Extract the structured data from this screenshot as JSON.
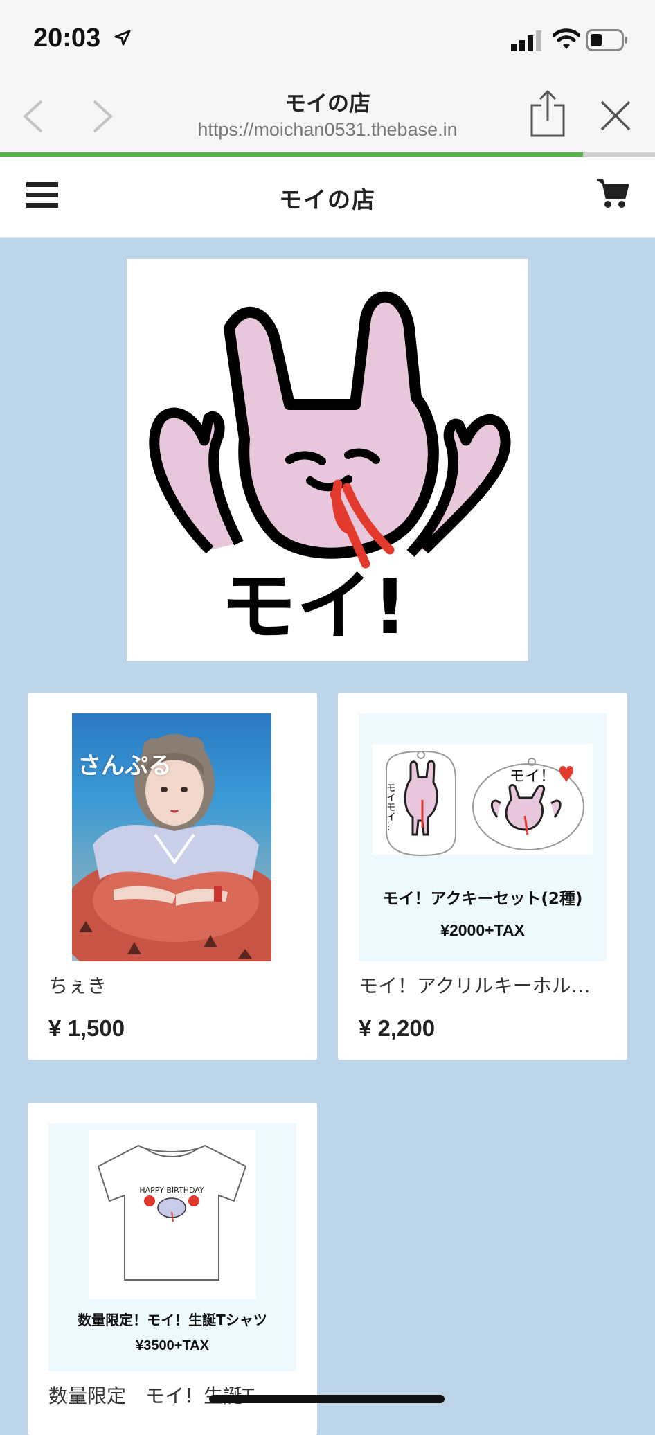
{
  "status_bar": {
    "time": "20:03"
  },
  "browser": {
    "title": "モイの店",
    "url": "https://moichan0531.thebase.in",
    "progress": 0.89
  },
  "store": {
    "title": "モイの店"
  },
  "hero": {
    "image_text": "モイ!"
  },
  "products": [
    {
      "name": "ちぇき",
      "price": "¥ 1,500",
      "image_label": "さんぷる"
    },
    {
      "name": "モイ！アクリルキーホルダー",
      "price": "¥ 2,200",
      "image_caption_1": "モイ！アクキーセット(2種)",
      "image_caption_2": "¥2000+TAX",
      "sticker_text_1": "モイモイ…",
      "sticker_text_2": "モイ！"
    },
    {
      "name": "数量限定　モイ！生誕T",
      "image_caption_1": "数量限定！モイ！生誕Tシャツ",
      "image_caption_2": "¥3500+TAX",
      "shirt_text": "HAPPY BIRTHDAY"
    }
  ],
  "colors": {
    "page_bg": "#bed5e9",
    "progress": "#5ab34a",
    "pink": "#e8c6dc",
    "red": "#e23a2c"
  }
}
